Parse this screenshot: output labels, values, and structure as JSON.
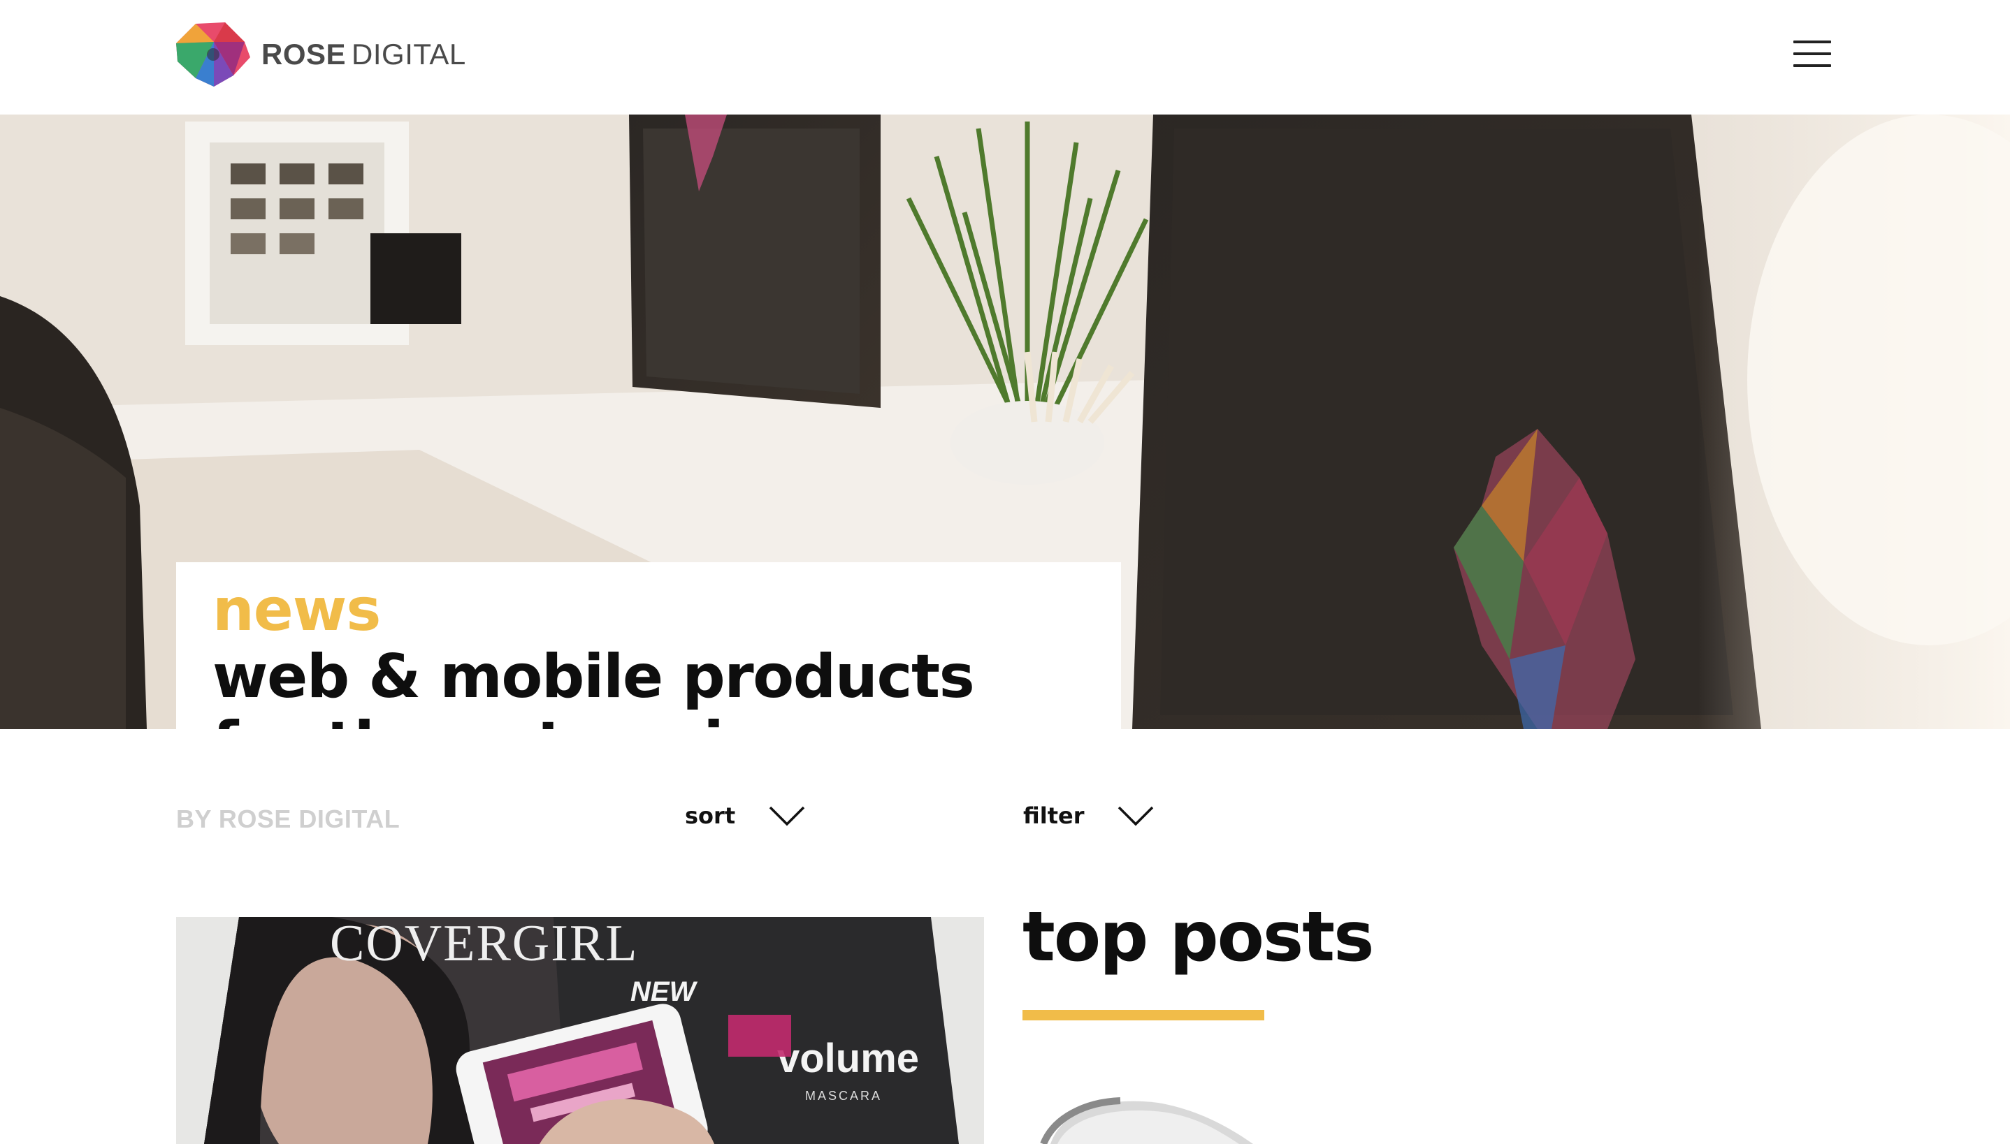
{
  "header": {
    "logo_bold": "ROSE",
    "logo_light": "DIGITAL",
    "menu_icon": "hamburger-menu-icon"
  },
  "hero": {
    "kicker": "news",
    "title_line1": "web & mobile products",
    "title_line2": "for the enterprise"
  },
  "controls": {
    "byline": "BY ROSE DIGITAL",
    "sort_label": "sort",
    "filter_label": "filter",
    "chevron_icon": "chevron-down-icon"
  },
  "sidebar": {
    "title": "top posts"
  },
  "post_image_text": {
    "brand": "COVERGIRL",
    "new": "NEW",
    "product": "volume",
    "sub": "MASCARA"
  },
  "colors": {
    "accent": "#f1bc49",
    "text": "#0e0e0e",
    "byline": "#cfcfcf"
  }
}
